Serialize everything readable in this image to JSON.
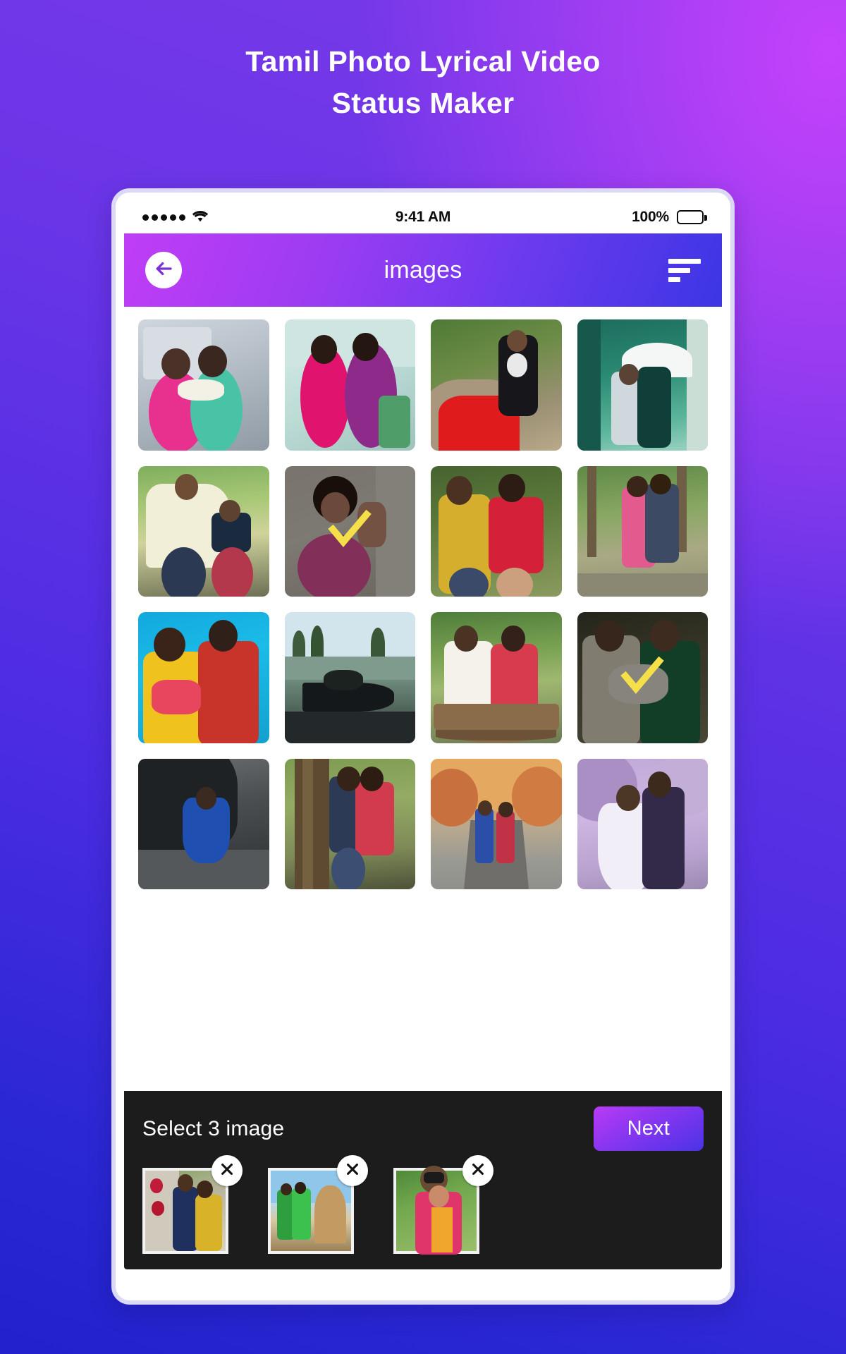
{
  "promo": {
    "line1": "Tamil Photo Lyrical Video",
    "line2": "Status Maker"
  },
  "colors": {
    "bg_top_left": "#6c3ce6",
    "bg_top_right": "#c442fc",
    "bg_bottom": "#2122cc",
    "appbar_start": "#c03df6",
    "appbar_end": "#3c36e4",
    "check_yellow": "#f5e04a",
    "bottom_bar": "#1c1c1c",
    "next_start": "#b93bf5",
    "next_end": "#4a33e8"
  },
  "status_bar": {
    "signal_dots": 5,
    "wifi": "wifi-icon",
    "time": "9:41 AM",
    "battery_percent": "100%",
    "battery_icon": "battery-full-icon"
  },
  "app_bar": {
    "back_icon": "arrow-left-icon",
    "title": "images",
    "sort_icon": "sort-icon"
  },
  "grid": {
    "columns": 4,
    "items": [
      {
        "id": 1,
        "alt": "couple in garlands with sunglasses",
        "selected": false
      },
      {
        "id": 2,
        "alt": "two women in sarees indoors",
        "selected": false
      },
      {
        "id": 3,
        "alt": "man in suit with red saree on rock",
        "selected": false
      },
      {
        "id": 4,
        "alt": "couple under white umbrella",
        "selected": false
      },
      {
        "id": 5,
        "alt": "man arms wide with woman on road",
        "selected": false
      },
      {
        "id": 6,
        "alt": "bride in pink saree by wall",
        "selected": true
      },
      {
        "id": 7,
        "alt": "couple yellow jacket red dress",
        "selected": false
      },
      {
        "id": 8,
        "alt": "couple walking under trees",
        "selected": false
      },
      {
        "id": 9,
        "alt": "couple in red by blue water",
        "selected": false
      },
      {
        "id": 10,
        "alt": "couple lying on boat backwaters",
        "selected": false
      },
      {
        "id": 11,
        "alt": "couple seated in wooden boat",
        "selected": false
      },
      {
        "id": 12,
        "alt": "wedding couple with garlands",
        "selected": true
      },
      {
        "id": 13,
        "alt": "woman in blue on rock cliff",
        "selected": false
      },
      {
        "id": 14,
        "alt": "couple leaning on tree trunk",
        "selected": false
      },
      {
        "id": 15,
        "alt": "couple on autumn road",
        "selected": false
      },
      {
        "id": 16,
        "alt": "bride in white gown with groom",
        "selected": false
      }
    ]
  },
  "bottom_bar": {
    "label": "Select 3 image",
    "next_label": "Next",
    "selected_thumbs": [
      {
        "id": "s1",
        "alt": "groom navy suit bride yellow saree",
        "remove_icon": "close-icon"
      },
      {
        "id": "s2",
        "alt": "couple in green at stone temple",
        "remove_icon": "close-icon"
      },
      {
        "id": "s3",
        "alt": "couple in pink saree outdoors",
        "remove_icon": "close-icon"
      }
    ]
  }
}
